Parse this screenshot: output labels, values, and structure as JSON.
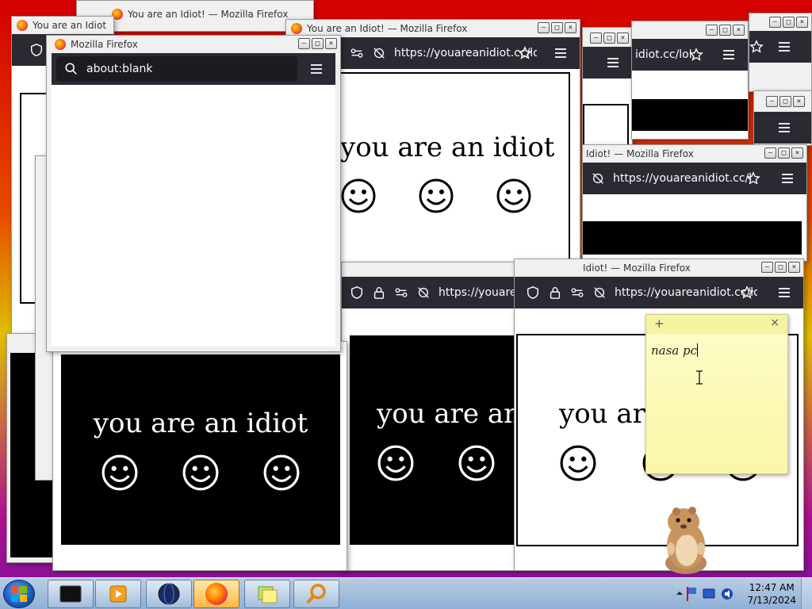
{
  "windows": {
    "top_center": {
      "title": "You are an Idiot! — Mozilla Firefox"
    },
    "top_left": {
      "title": "You are an Idiot"
    },
    "blank": {
      "title": "Mozilla Firefox",
      "url": "about:blank"
    },
    "top_mid": {
      "title": "You are an Idiot! — Mozilla Firefox",
      "url": "https://youareanidiot.cc/lol."
    },
    "right_a": {
      "url": "idiot.cc/lol."
    },
    "right_mid": {
      "title": "Idiot! — Mozilla Firefox",
      "url": "https://youareanidiot.cc/lol."
    },
    "center_bottom": {
      "url": "https://youareani"
    },
    "bottom_right": {
      "title": "Idiot! — Mozilla Firefox",
      "url": "https://youareanidiot.cc/lol."
    }
  },
  "page": {
    "message": "you are an idiot"
  },
  "sticky_note": {
    "text": "nasa pc",
    "add_glyph": "+",
    "close_glyph": "×"
  },
  "caption_buttons": {
    "minimize": "–",
    "maximize": "□",
    "close": "×"
  },
  "taskbar": {
    "time": "12:47 AM",
    "date": "7/13/2024"
  },
  "colors": {
    "toolbar": "#2b2a33",
    "urlbar": "#1c1b22",
    "sticky": "#fdfdc9",
    "taskbar": "#a6c0df"
  }
}
